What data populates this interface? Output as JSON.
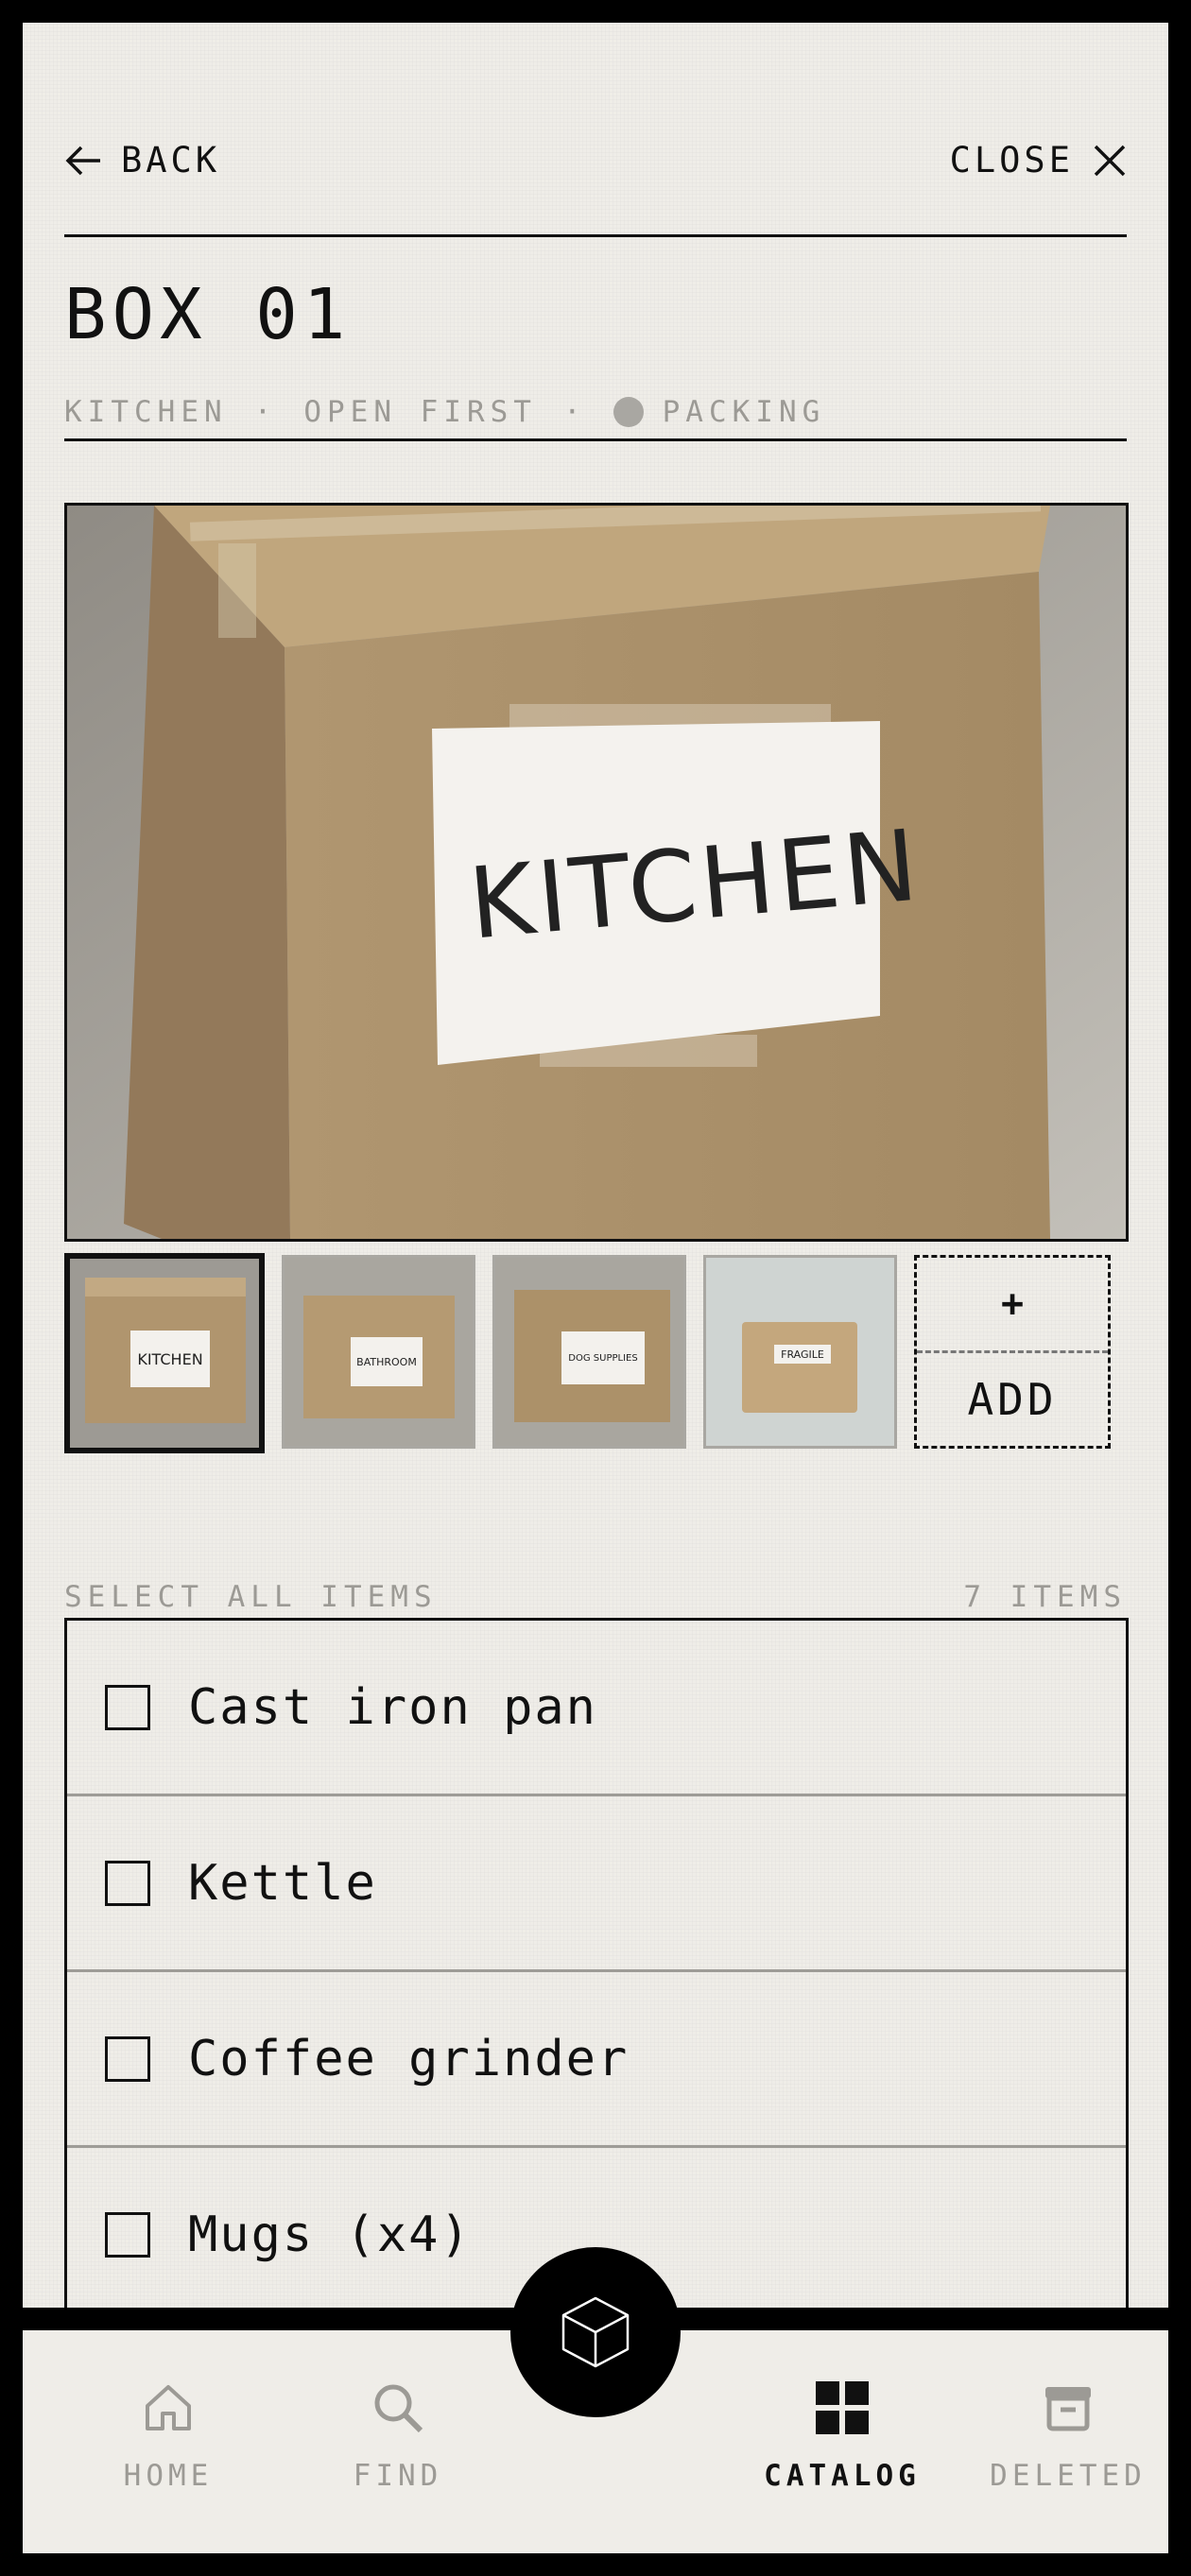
{
  "header": {
    "back_label": "BACK",
    "close_label": "CLOSE"
  },
  "box": {
    "title": "BOX 01",
    "room": "KITCHEN",
    "separator": "·",
    "priority": "OPEN FIRST",
    "status": "PACKING",
    "label_text": "KITCHEN"
  },
  "thumbnails": [
    {
      "label": "KITCHEN",
      "selected": true
    },
    {
      "label": "BATHROOM"
    },
    {
      "label": "DOG SUPPLIES"
    },
    {
      "label": "FRAGILE"
    }
  ],
  "add_tile": {
    "plus": "+",
    "label": "ADD"
  },
  "items_section": {
    "select_all": "SELECT ALL ITEMS",
    "count": "7 ITEMS"
  },
  "items": [
    {
      "label": "Cast iron pan",
      "checked": false
    },
    {
      "label": "Kettle",
      "checked": false
    },
    {
      "label": "Coffee grinder",
      "checked": false
    },
    {
      "label": "Mugs (x4)",
      "checked": false
    }
  ],
  "bottom_nav": {
    "home": "HOME",
    "find": "FIND",
    "catalog": "CATALOG",
    "deleted": "DELETED",
    "active": "catalog"
  },
  "colors": {
    "ink": "#111111",
    "muted": "#9c9a95",
    "paper": "#efede8",
    "cardboard": "#b39a72"
  }
}
